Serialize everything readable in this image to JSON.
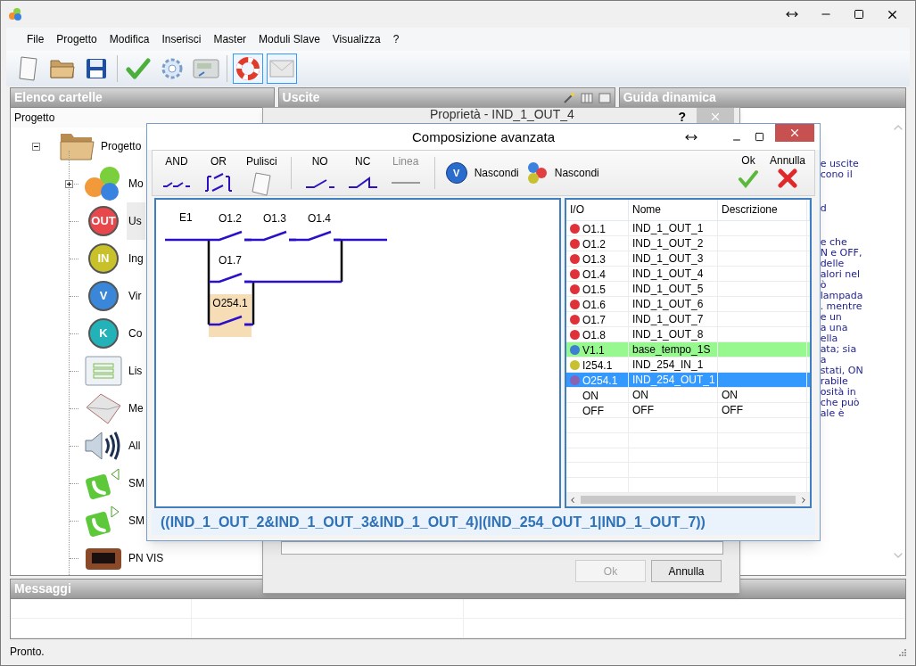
{
  "menu": [
    "File",
    "Progetto",
    "Modifica",
    "Inserisci",
    "Master",
    "Moduli Slave",
    "Visualizza",
    "?"
  ],
  "toolbar": [
    {
      "kind": "new"
    },
    {
      "kind": "open"
    },
    {
      "kind": "save"
    },
    {
      "kind": "separator"
    },
    {
      "kind": "check"
    },
    {
      "kind": "settings"
    },
    {
      "kind": "device"
    },
    {
      "kind": "separator"
    },
    {
      "kind": "help",
      "pressed": true
    },
    {
      "kind": "mail",
      "pressed": true
    }
  ],
  "folders_panel": {
    "title": "Elenco cartelle",
    "header": "Progetto",
    "tree": [
      {
        "label": "Progetto",
        "kind": "folder",
        "expanded": true,
        "selected": false,
        "children": [
          {
            "label": "Mo",
            "kind": "modules",
            "expanded": false,
            "selected": false
          },
          {
            "label": "Us",
            "kind": "badge",
            "icon_text": "OUT",
            "color": "#e8474c",
            "selected": true
          },
          {
            "label": "Ing",
            "kind": "badge",
            "icon_text": "IN",
            "color": "#c9c12a",
            "selected": false
          },
          {
            "label": "Vir",
            "kind": "badge",
            "icon_text": "V",
            "color": "#3a86d8",
            "selected": false
          },
          {
            "label": "Co",
            "kind": "badge",
            "icon_text": "K",
            "color": "#22b2b8",
            "selected": false
          },
          {
            "label": "Lis",
            "kind": "list",
            "selected": false
          },
          {
            "label": "Me",
            "kind": "message",
            "selected": false
          },
          {
            "label": "All",
            "kind": "alarm",
            "selected": false
          },
          {
            "label": "SM",
            "kind": "sms_in",
            "selected": false
          },
          {
            "label": "SM",
            "kind": "sms_out",
            "selected": false
          },
          {
            "label": "PN VIS",
            "kind": "display",
            "selected": false
          }
        ]
      }
    ]
  },
  "outputs_panel": {
    "title": "Uscite"
  },
  "help_panel": {
    "title": "Guida dinamica",
    "paragraphs": [
      [
        "e uscite",
        "cono il"
      ],
      [
        "d"
      ],
      [
        "e che",
        "N e OFF,",
        "delle",
        "alori nel",
        "ò",
        "lampada",
        ". mentre",
        "e un",
        "a una",
        "ella",
        "ata; sia",
        "a",
        "stati, ON",
        "rabile",
        "osità in",
        "che può",
        "ale è"
      ]
    ]
  },
  "messages_panel": {
    "title": "Messaggi"
  },
  "status_bar": {
    "text": "Pronto."
  },
  "properties_dialog": {
    "title": "Proprietà - IND_1_OUT_4",
    "help": "?",
    "buttons": [
      {
        "label": "Ok",
        "disabled": true
      },
      {
        "label": "Annulla",
        "disabled": false
      }
    ]
  },
  "composer_dialog": {
    "title": "Composizione avanzata",
    "tools": [
      {
        "label": "AND",
        "kind": "and",
        "disabled": false
      },
      {
        "label": "OR",
        "kind": "or",
        "disabled": false
      },
      {
        "label": "Pulisci",
        "kind": "clear",
        "disabled": false
      },
      {
        "kind": "separator"
      },
      {
        "label": "NO",
        "kind": "no",
        "disabled": false
      },
      {
        "label": "NC",
        "kind": "nc",
        "disabled": false
      },
      {
        "label": "Linea",
        "kind": "line",
        "disabled": true
      },
      {
        "kind": "separator"
      },
      {
        "label": "Nascondi",
        "kind": "hide_virtual",
        "icon_text": "V"
      },
      {
        "label": "Nascondi",
        "kind": "hide_io"
      }
    ],
    "actions": [
      {
        "label": "Ok",
        "kind": "ok"
      },
      {
        "label": "Annulla",
        "kind": "cancel"
      }
    ],
    "diagram": {
      "input_label": "E1",
      "contacts": [
        {
          "label": "O1.2",
          "selected": false
        },
        {
          "label": "O1.3",
          "selected": false
        },
        {
          "label": "O1.4",
          "selected": false
        },
        {
          "label": "O1.7",
          "selected": false
        },
        {
          "label": "O254.1",
          "selected": true
        }
      ]
    },
    "table": {
      "columns": [
        "I/O",
        "Nome",
        "Descrizione"
      ],
      "rows": [
        {
          "io": "O1.1",
          "name": "IND_1_OUT_1",
          "color": "#e0303a",
          "highlighted": false,
          "selected": false
        },
        {
          "io": "O1.2",
          "name": "IND_1_OUT_2",
          "color": "#e0303a",
          "highlighted": false,
          "selected": false
        },
        {
          "io": "O1.3",
          "name": "IND_1_OUT_3",
          "color": "#e0303a",
          "highlighted": false,
          "selected": false
        },
        {
          "io": "O1.4",
          "name": "IND_1_OUT_4",
          "color": "#e0303a",
          "highlighted": false,
          "selected": false
        },
        {
          "io": "O1.5",
          "name": "IND_1_OUT_5",
          "color": "#e0303a",
          "highlighted": false,
          "selected": false
        },
        {
          "io": "O1.6",
          "name": "IND_1_OUT_6",
          "color": "#e0303a",
          "highlighted": false,
          "selected": false
        },
        {
          "io": "O1.7",
          "name": "IND_1_OUT_7",
          "color": "#e0303a",
          "highlighted": false,
          "selected": false
        },
        {
          "io": "O1.8",
          "name": "IND_1_OUT_8",
          "color": "#e0303a",
          "highlighted": false,
          "selected": false
        },
        {
          "io": "V1.1",
          "name": "base_tempo_1S",
          "color": "#3d7fd0",
          "highlighted": true,
          "selected": false
        },
        {
          "io": "I254.1",
          "name": "IND_254_IN_1",
          "color": "#c8c030",
          "highlighted": false,
          "selected": false
        },
        {
          "io": "O254.1",
          "name": "IND_254_OUT_1",
          "color": "#8a62b4",
          "highlighted": false,
          "selected": true
        },
        {
          "io": "ON",
          "name": "ON",
          "description": "ON",
          "highlighted": false,
          "selected": false
        },
        {
          "io": "OFF",
          "name": "OFF",
          "description": "OFF",
          "highlighted": false,
          "selected": false
        }
      ]
    },
    "expression": "((IND_1_OUT_2&IND_1_OUT_3&IND_1_OUT_4)|(IND_254_OUT_1|IND_1_OUT_7))"
  }
}
